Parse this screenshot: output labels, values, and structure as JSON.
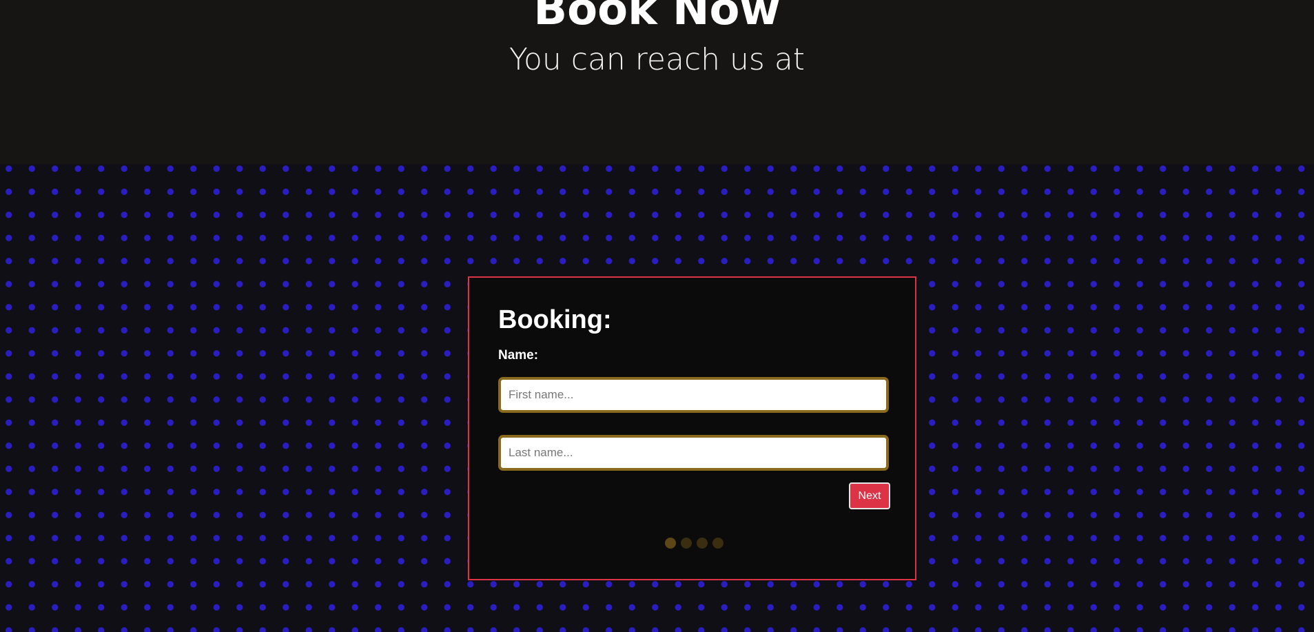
{
  "header": {
    "title": "Book Now",
    "subtitle": "You can reach us at"
  },
  "booking": {
    "heading": "Booking:",
    "name_label": "Name:",
    "first_name_placeholder": "First name...",
    "last_name_placeholder": "Last name...",
    "next_label": "Next",
    "steps": [
      {
        "active": true
      },
      {
        "active": false
      },
      {
        "active": false
      },
      {
        "active": false
      }
    ]
  },
  "colors": {
    "accent": "#dc3446",
    "dots": "#2a1ec2",
    "input_border": "#8a6a1c",
    "background": "#161514"
  }
}
